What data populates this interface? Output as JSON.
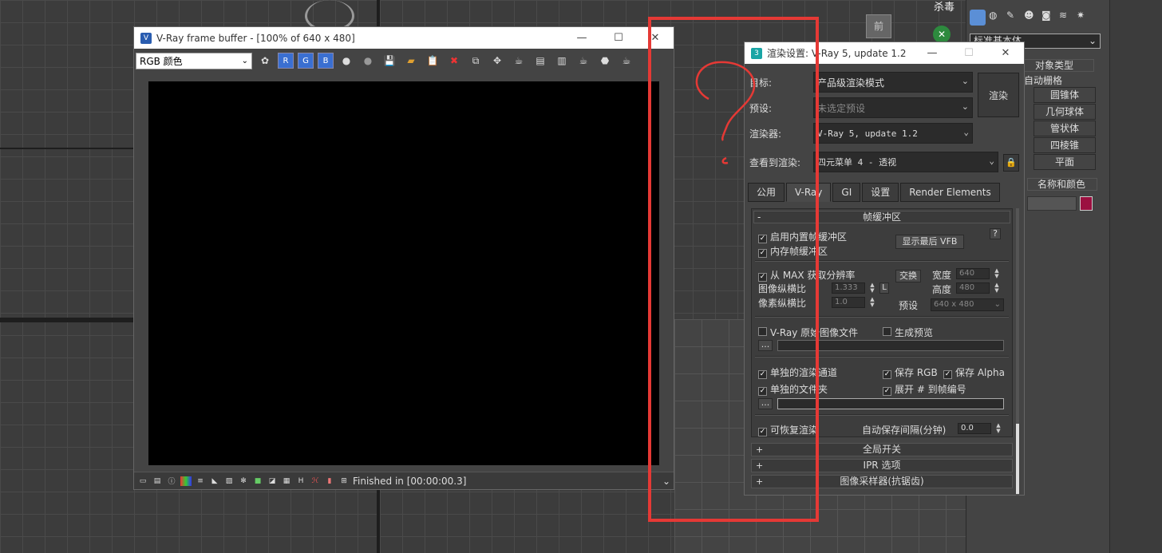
{
  "vfb": {
    "title": "V-Ray frame buffer - [100% of 640 x 480]",
    "channel": "RGB 颜色",
    "channel_buttons": [
      "R",
      "G",
      "B"
    ],
    "status": "Finished in [00:00:00.3]"
  },
  "render_settings": {
    "title": "渲染设置: V-Ray 5, update 1.2",
    "target_label": "目标:",
    "target_value": "产品级渲染模式",
    "preset_label": "预设:",
    "preset_value": "未选定预设",
    "renderer_label": "渲染器:",
    "renderer_value": "V-Ray 5, update 1.2",
    "view_label": "查看到渲染:",
    "view_value": "四元菜单 4 - 透视",
    "render_button": "渲染",
    "tabs": [
      "公用",
      "V-Ray",
      "GI",
      "设置",
      "Render Elements"
    ],
    "active_tab": "V-Ray",
    "frame_buffer": {
      "header": "帧缓冲区",
      "collapse": "-",
      "enable_builtin": "启用内置帧缓冲区",
      "memory_fb": "内存帧缓冲区",
      "show_last_vfb": "显示最后 VFB",
      "help": "?",
      "get_res_from_max": "从 MAX 获取分辨率",
      "image_aspect_label": "图像纵横比",
      "image_aspect": "1.333",
      "lock": "L",
      "pixel_aspect_label": "像素纵横比",
      "pixel_aspect": "1.0",
      "swap": "交换",
      "width_label": "宽度",
      "width": "640",
      "height_label": "高度",
      "height": "480",
      "preset_label": "预设",
      "preset": "640 x 480",
      "vray_raw_image": "V-Ray 原始图像文件",
      "gen_preview": "生成预览",
      "browse": "...",
      "separate_channels": "单独的渲染通道",
      "save_rgb": "保存 RGB",
      "save_alpha": "保存 Alpha",
      "separate_folders": "单独的文件夹",
      "expand_frame": "展开 # 到帧编号",
      "resumable": "可恢复渲染",
      "autosave_label": "自动保存间隔(分钟)",
      "autosave": "0.0"
    },
    "rollouts": [
      "全局开关",
      "IPR 选项",
      "图像采样器(抗锯齿)"
    ]
  },
  "right_panel": {
    "top_label": "杀毒",
    "dropdown": "标准基本体",
    "object_type": "对象类型",
    "grid": "自动栅格",
    "items": [
      "圆锥体",
      "几何球体",
      "管状体",
      "四棱锥",
      "平面"
    ],
    "name_color": "名称和颜色"
  },
  "viewport": {
    "cube_label": "前"
  },
  "colors": {
    "annotation": "#e53935",
    "channel_blue": "#3a6fd1",
    "color_swatch": "#9b1040"
  }
}
